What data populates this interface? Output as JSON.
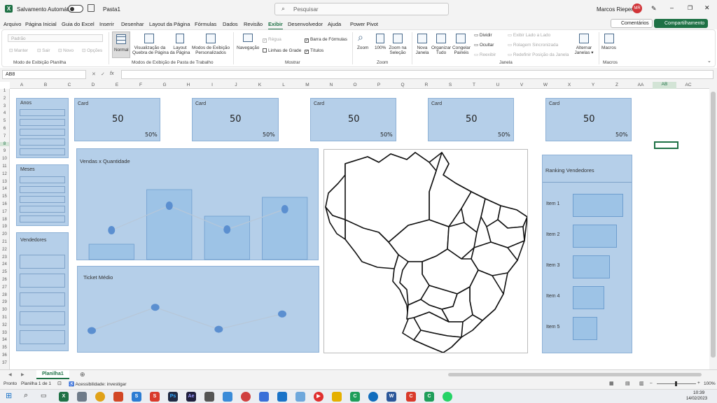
{
  "titlebar": {
    "autosave_label": "Salvamento Automático",
    "doc_name": "Pasta1",
    "search_placeholder": "Pesquisar",
    "user_name": "Marcos Rieper",
    "user_initials": "MR"
  },
  "menu": {
    "tabs": [
      "Arquivo",
      "Página Inicial",
      "Guia do Excel",
      "Inserir",
      "Desenhar",
      "Layout da Página",
      "Fórmulas",
      "Dados",
      "Revisão",
      "Exibir",
      "Desenvolvedor",
      "Ajuda",
      "Power Pivot"
    ],
    "active": "Exibir",
    "comments_label": "Comentários",
    "share_label": "Compartilhamento"
  },
  "ribbon": {
    "modo_planilha": {
      "dropdown": "Padrão",
      "manter": "Manter",
      "sair": "Sair",
      "novo": "Novo",
      "opcoes": "Opções",
      "label": "Modo de Exibição Planilha"
    },
    "modos_pasta": {
      "normal": "Normal",
      "quebra_1": "Visualização da",
      "quebra_2": "Quebra de Página",
      "layout_1": "Layout",
      "layout_2": "da Página",
      "pers_1": "Modos de Exibição",
      "pers_2": "Personalizados",
      "label": "Modos de Exibição de Pasta de Trabalho"
    },
    "mostrar": {
      "navegacao": "Navegação",
      "regua": "Régua",
      "linhas": "Linhas de Grade",
      "barra": "Barra de Fórmulas",
      "titulos": "Títulos",
      "label": "Mostrar"
    },
    "zoom": {
      "zoom": "Zoom",
      "cem": "100%",
      "sel_1": "Zoom na",
      "sel_2": "Seleção",
      "label": "Zoom"
    },
    "janela": {
      "nova_1": "Nova",
      "nova_2": "Janela",
      "org_1": "Organizar",
      "org_2": "Tudo",
      "cong_1": "Congelar",
      "cong_2": "Painéis",
      "dividir": "Dividir",
      "ocultar": "Ocultar",
      "reexibir": "Reexibir",
      "lado": "Exibir Lado a Lado",
      "rolagem": "Rolagem Sincronizada",
      "redef": "Redefinir Posição da Janela",
      "alt_1": "Alternar",
      "alt_2": "Janelas",
      "label": "Janela"
    },
    "macros": {
      "macros": "Macros",
      "label": "Macros"
    }
  },
  "formula_bar": {
    "cell": "AB8",
    "fx": "fx",
    "value": ""
  },
  "columns": [
    "A",
    "B",
    "C",
    "D",
    "E",
    "F",
    "G",
    "H",
    "I",
    "J",
    "K",
    "L",
    "M",
    "N",
    "O",
    "P",
    "Q",
    "R",
    "S",
    "T",
    "U",
    "V",
    "W",
    "X",
    "Y",
    "Z",
    "AA",
    "AB",
    "AC"
  ],
  "rows": [
    "1",
    "2",
    "3",
    "4",
    "5",
    "6",
    "7",
    "8",
    "9",
    "10",
    "11",
    "12",
    "13",
    "14",
    "15",
    "16",
    "17",
    "18",
    "19",
    "20",
    "21",
    "22",
    "23",
    "24",
    "25",
    "26",
    "27",
    "28",
    "29",
    "30",
    "31",
    "32",
    "33",
    "34",
    "35",
    "36",
    "37"
  ],
  "slicers": {
    "anos": "Anos",
    "meses": "Meses",
    "vendedores": "Vendedores"
  },
  "cards": [
    {
      "title": "Card",
      "value": "50",
      "pct": "50%"
    },
    {
      "title": "Card",
      "value": "50",
      "pct": "50%"
    },
    {
      "title": "Card",
      "value": "50",
      "pct": "50%"
    },
    {
      "title": "Card",
      "value": "50",
      "pct": "50%"
    },
    {
      "title": "Card",
      "value": "50",
      "pct": "50%"
    }
  ],
  "chart_data": [
    {
      "type": "bar",
      "title": "Vendas x Quantidade",
      "series": [
        {
          "kind": "bar",
          "values": [
            22,
            100,
            62,
            89
          ]
        },
        {
          "kind": "line",
          "values": [
            42,
            77,
            43,
            72
          ]
        }
      ],
      "ylim": [
        0,
        100
      ],
      "colors": {
        "bar": "#9dc3e6",
        "line": "#b7c7d8",
        "marker": "#5b8fd0"
      }
    },
    {
      "type": "line",
      "title": "Ticket Médio",
      "series": [
        {
          "values": [
            30,
            65,
            32,
            55
          ]
        }
      ],
      "ylim": [
        0,
        100
      ],
      "colors": {
        "line": "#b7c7d8",
        "marker": "#5b8fd0"
      }
    },
    {
      "type": "bar",
      "title": "Ranking Vendedores",
      "categories": [
        "Item 1",
        "Item 2",
        "Item 3",
        "Item 4",
        "Item 5"
      ],
      "values": [
        100,
        87,
        74,
        62,
        48
      ],
      "colors": {
        "bar": "#9dc3e6"
      }
    }
  ],
  "sheet_tabs": {
    "active": "Planilha1"
  },
  "status": {
    "ready": "Pronto",
    "sheet_of": "Planilha 1 de 1",
    "accessibility": "Acessibilidade: investigar",
    "zoom": "100%"
  },
  "taskbar": {
    "time": "10:39",
    "date": "14/02/2023"
  },
  "colors": {
    "accent": "#1e7145",
    "panel": "#b5cfe9"
  }
}
